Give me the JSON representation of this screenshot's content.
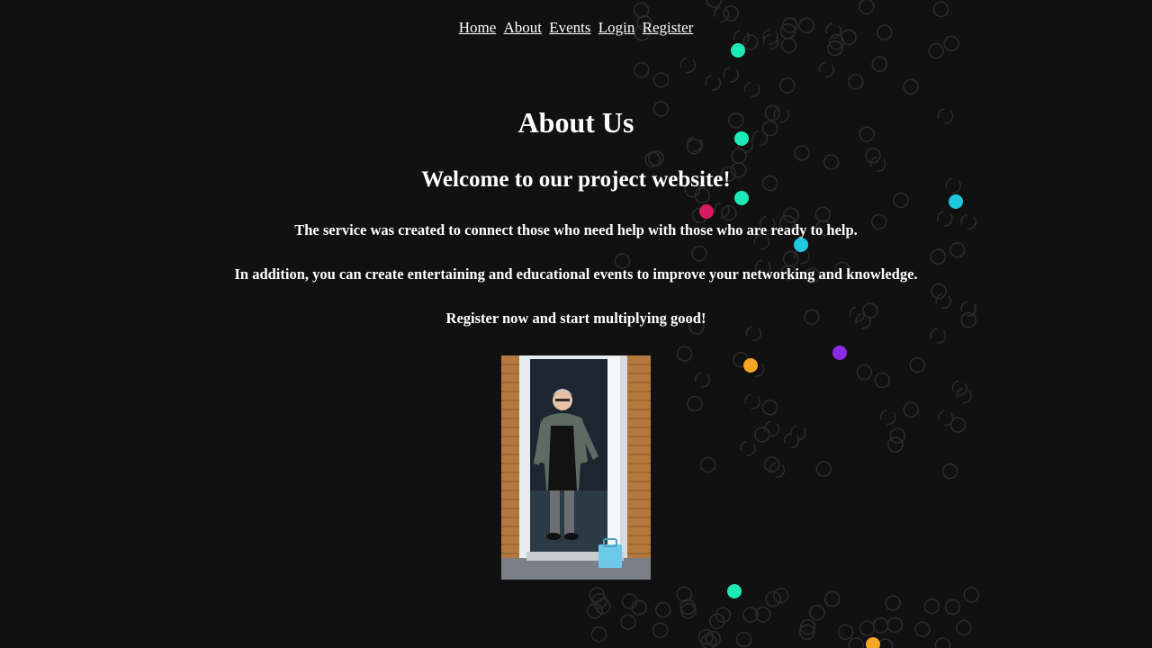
{
  "nav": {
    "items": [
      "Home",
      "About",
      "Events",
      "Login",
      "Register"
    ]
  },
  "main": {
    "title": "About Us",
    "subtitle": "Welcome to our project website!",
    "paragraphs": [
      "The service was created to connect those who need help with those who are ready to help.",
      "In addition, you can create entertaining and educational events to improve your networking and knowledge.",
      "Register now and start multiplying good!"
    ],
    "image_subject": "volunteer-at-doorway-photo"
  },
  "colors": {
    "background": "#111111",
    "text": "#ffffff",
    "accent_teal": "#1de9b6",
    "accent_cyan": "#1ec8e0",
    "accent_pink": "#d81b60",
    "accent_purple": "#8a2be2",
    "accent_orange": "#f5a623"
  }
}
